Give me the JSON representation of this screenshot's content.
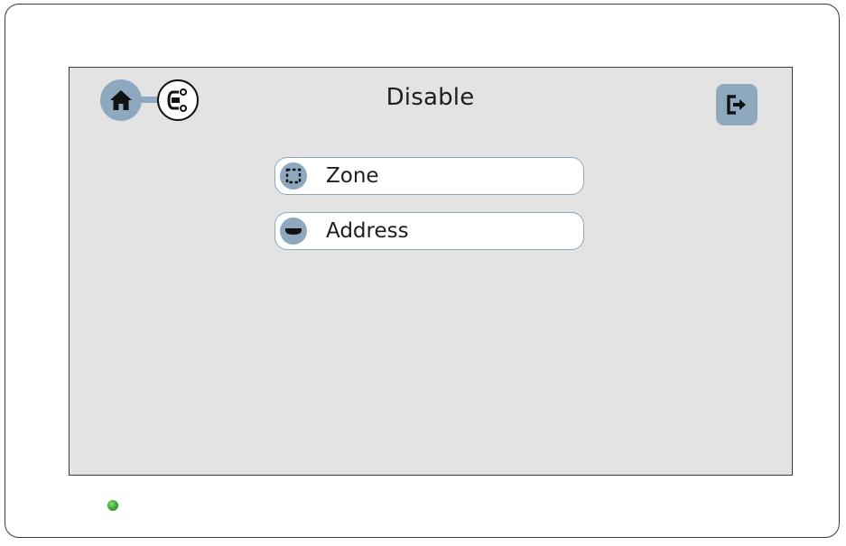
{
  "header": {
    "title": "Disable",
    "home_icon": "home-icon",
    "context_icon": "logic-circuit-icon",
    "exit_icon": "exit-icon"
  },
  "menu": {
    "items": [
      {
        "label": "Zone",
        "icon": "zone-dashed-square-icon"
      },
      {
        "label": "Address",
        "icon": "detector-icon"
      }
    ]
  },
  "status": {
    "led_color": "#3aa23a",
    "led_icon": "power-led-icon"
  },
  "colors": {
    "accent": "#8ea8c0",
    "screen_bg": "#e3e3e3",
    "text": "#1e1e1e"
  }
}
